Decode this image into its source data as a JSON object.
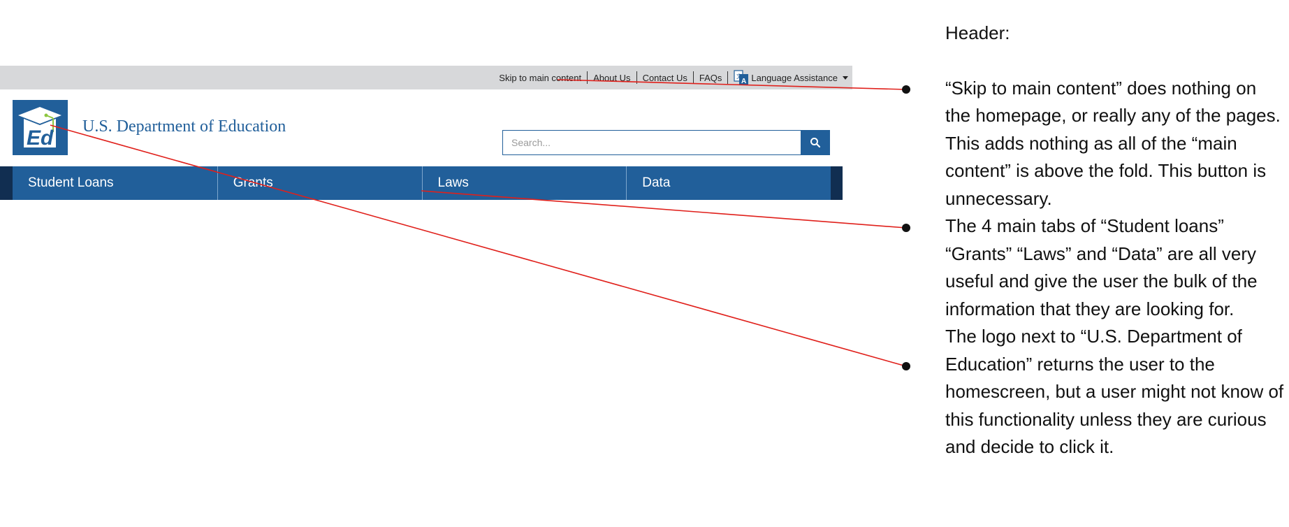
{
  "utility_bar": {
    "links": [
      "Skip to main content",
      "About Us",
      "Contact Us",
      "FAQs"
    ],
    "language_label": "Language Assistance"
  },
  "brand": {
    "agency_name": "U.S. Department of Education",
    "logo_text": "Ed"
  },
  "search": {
    "placeholder": "Search..."
  },
  "main_nav": {
    "items": [
      "Student Loans",
      "Grants",
      "Laws",
      "Data"
    ]
  },
  "notes": {
    "heading": "Header:",
    "items": [
      "“Skip to main content” does nothing on the homepage, or really any of the pages. This adds nothing as all of the “main content” is above the fold. This button is unnecessary.",
      "The 4 main tabs of “Student loans” “Grants” “Laws” and “Data” are all very useful and give the user the bulk of the information that they are looking for.",
      "The logo next to “U.S. Department of Education” returns the user to the homescreen, but a user might not know of this functionality unless they are curious and decide to click it."
    ]
  },
  "colors": {
    "brand_blue": "#215f9a",
    "nav_dark": "#112e51",
    "utility_bg": "#d7d8da",
    "annotation_red": "#e0201b"
  },
  "icons": {
    "logo": "graduation-cap-logo",
    "search": "magnifier-icon",
    "language": "translate-icon",
    "dropdown": "caret-down-icon"
  }
}
